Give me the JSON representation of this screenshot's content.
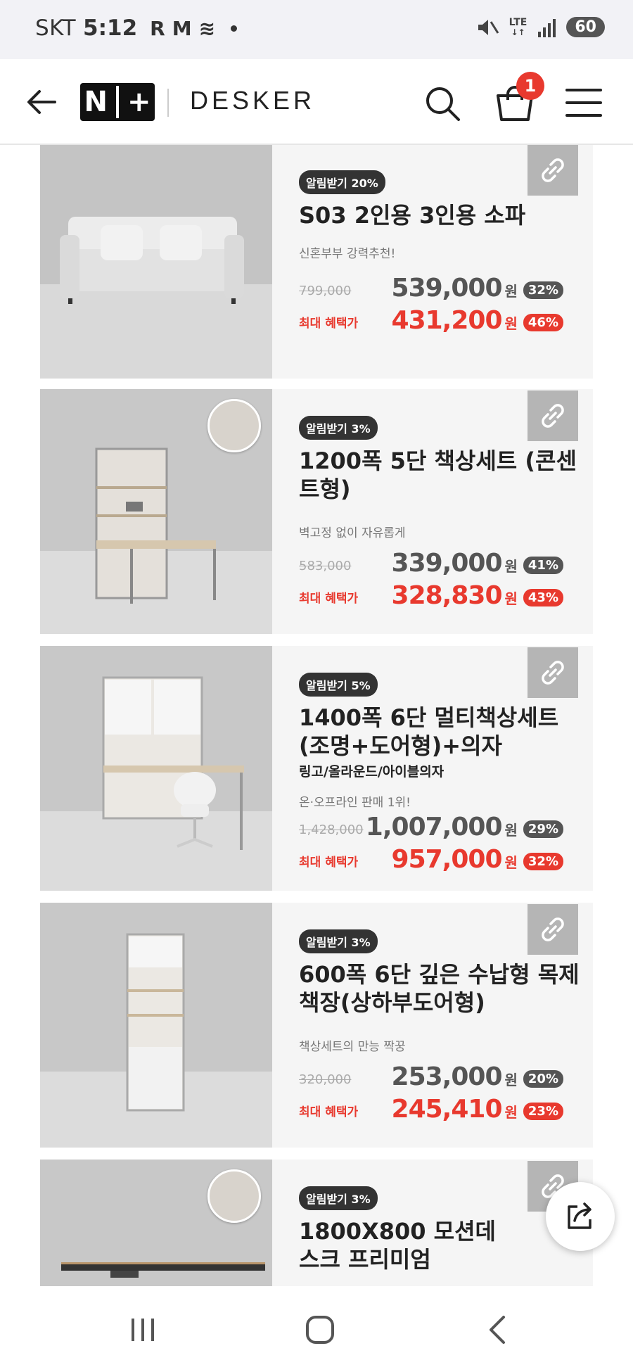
{
  "status_bar": {
    "carrier": "SKT",
    "time": "5:12",
    "app_icons": [
      "R",
      "M",
      "≋"
    ],
    "network": "LTE",
    "battery": "60"
  },
  "header": {
    "logo_text": [
      "N",
      "+"
    ],
    "brand": "DESKER",
    "cart_count": "1"
  },
  "products": [
    {
      "alert": "알림받기 20%",
      "title": "S03 2인용 3인용 소파",
      "subtitle": "",
      "tagline": "신혼부부 강력추천!",
      "original_price": "799,000",
      "price": "539,000",
      "price_unit": "원",
      "discount": "32%",
      "benefit_label": "최대 혜택가",
      "benefit_price": "431,200",
      "benefit_unit": "원",
      "benefit_discount": "46%"
    },
    {
      "alert": "알림받기 3%",
      "title": "1200폭 5단 책상세트 (콘센트형)",
      "subtitle": "",
      "tagline": "벽고정 없이 자유롭게",
      "original_price": "583,000",
      "price": "339,000",
      "price_unit": "원",
      "discount": "41%",
      "benefit_label": "최대 혜택가",
      "benefit_price": "328,830",
      "benefit_unit": "원",
      "benefit_discount": "43%"
    },
    {
      "alert": "알림받기 5%",
      "title": "1400폭 6단 멀티책상세트 (조명+도어형)+의자",
      "subtitle": "링고/올라운드/아이블의자",
      "tagline": "온·오프라인 판매 1위!",
      "original_price": "1,428,000",
      "price": "1,007,000",
      "price_unit": "원",
      "discount": "29%",
      "benefit_label": "최대 혜택가",
      "benefit_price": "957,000",
      "benefit_unit": "원",
      "benefit_discount": "32%"
    },
    {
      "alert": "알림받기 3%",
      "title": "600폭 6단 깊은 수납형 목제 책장(상하부도어형)",
      "subtitle": "",
      "tagline": "책상세트의 만능 짝꿍",
      "original_price": "320,000",
      "price": "253,000",
      "price_unit": "원",
      "discount": "20%",
      "benefit_label": "최대 혜택가",
      "benefit_price": "245,410",
      "benefit_unit": "원",
      "benefit_discount": "23%"
    },
    {
      "alert": "알림받기 3%",
      "title": "1800X800 모션데스크 프리미엄"
    }
  ],
  "icons": {
    "back": "back-arrow-icon",
    "search": "search-icon",
    "cart": "cart-icon",
    "menu": "menu-icon",
    "link": "link-icon",
    "share": "share-icon",
    "nav_recents": "recents-icon",
    "nav_home": "home-icon",
    "nav_back": "nav-back-icon"
  },
  "colors": {
    "accent_red": "#e8392e",
    "badge_dark": "#333333",
    "price_gray": "#555555"
  }
}
